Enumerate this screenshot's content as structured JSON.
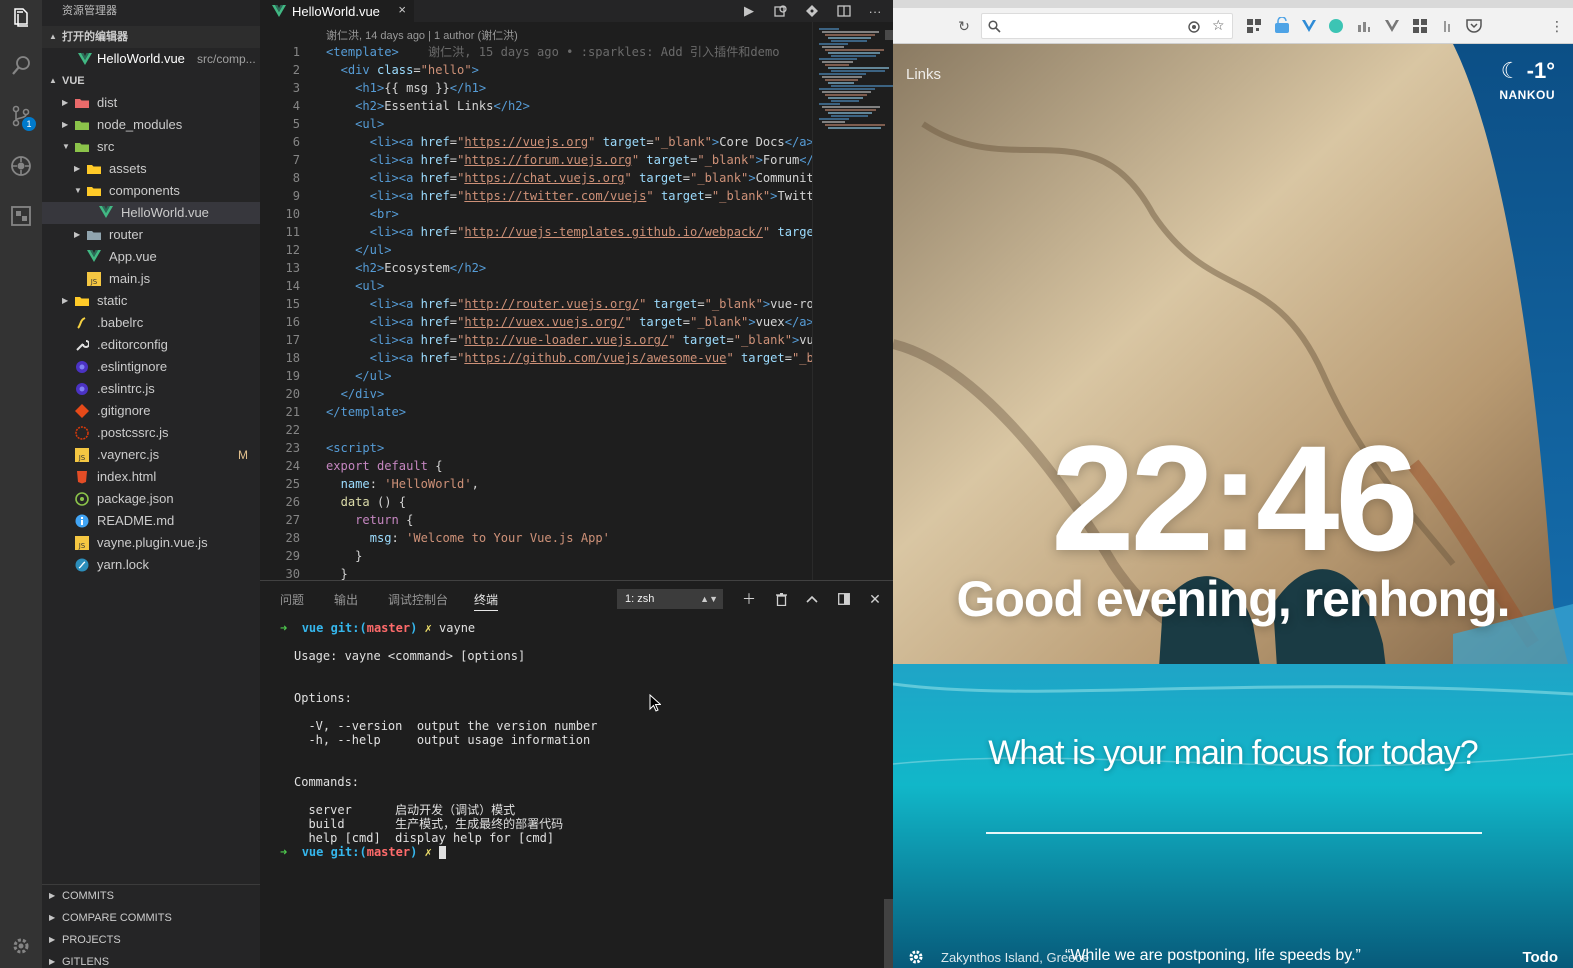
{
  "sidebar": {
    "title": "资源管理器",
    "open_editors": {
      "header": "打开的编辑器",
      "items": [
        {
          "name": "HelloWorld.vue",
          "path": "src/comp..."
        }
      ]
    },
    "project": {
      "header": "VUE",
      "tree": [
        {
          "name": "dist",
          "type": "folder"
        },
        {
          "name": "node_modules",
          "type": "folder"
        },
        {
          "name": "src",
          "type": "folder"
        },
        {
          "name": "assets",
          "type": "folder"
        },
        {
          "name": "components",
          "type": "folder"
        },
        {
          "name": "HelloWorld.vue",
          "type": "vue"
        },
        {
          "name": "router",
          "type": "folder"
        },
        {
          "name": "App.vue",
          "type": "vue"
        },
        {
          "name": "main.js",
          "type": "js"
        },
        {
          "name": "static",
          "type": "folder"
        },
        {
          "name": ".babelrc",
          "type": "babel"
        },
        {
          "name": ".editorconfig",
          "type": "config"
        },
        {
          "name": ".eslintignore",
          "type": "eslint"
        },
        {
          "name": ".eslintrc.js",
          "type": "eslint"
        },
        {
          "name": ".gitignore",
          "type": "git"
        },
        {
          "name": ".postcssrc.js",
          "type": "postcss"
        },
        {
          "name": ".vaynerc.js",
          "type": "js",
          "modified": "M"
        },
        {
          "name": "index.html",
          "type": "html"
        },
        {
          "name": "package.json",
          "type": "npm"
        },
        {
          "name": "README.md",
          "type": "info"
        },
        {
          "name": "vayne.plugin.vue.js",
          "type": "js"
        },
        {
          "name": "yarn.lock",
          "type": "yarn"
        }
      ]
    },
    "bottom_sections": [
      "COMMITS",
      "COMPARE COMMITS",
      "PROJECTS",
      "GITLENS"
    ]
  },
  "activity": {
    "scm_badge": "1"
  },
  "editor": {
    "tab_label": "HelloWorld.vue",
    "tab_close": "×",
    "blame_header": "谢仁洪, 14 days ago | 1 author (谢仁洪)",
    "blame_inline": "谢仁洪, 15 days ago • :sparkles: Add 引入插件和demo",
    "line_numbers": [
      "1",
      "2",
      "3",
      "4",
      "5",
      "6",
      "7",
      "8",
      "9",
      "10",
      "11",
      "12",
      "13",
      "14",
      "15",
      "16",
      "17",
      "18",
      "19",
      "20",
      "21",
      "22",
      "23",
      "24",
      "25",
      "26",
      "27",
      "28",
      "29",
      "30"
    ]
  },
  "panel": {
    "tabs": [
      "问题",
      "输出",
      "调试控制台",
      "终端"
    ],
    "terminal_select": "1: zsh",
    "terminal": {
      "prompt_dir": "vue",
      "prompt_git": "git:(",
      "prompt_branch": "master",
      "prompt_git_close": ")",
      "prompt_x": "✗",
      "command": "vayne",
      "usage": "Usage: vayne <command> [options]",
      "options_header": "Options:",
      "opt1": "  -V, --version  output the version number",
      "opt2": "  -h, --help     output usage information",
      "commands_header": "Commands:",
      "cmd1": "  server      启动开发（调试）模式",
      "cmd2": "  build       生产模式，生成最终的部署代码",
      "cmd3": "  help [cmd]  display help for [cmd]"
    }
  },
  "browser": {
    "links": "Links",
    "weather": {
      "temp": "-1°",
      "location": "NANKOU"
    },
    "clock": "22:46",
    "greeting": "Good evening, renhong.",
    "focus_question": "What is your main focus for today?",
    "footer_location": "Zakynthos Island, Greece",
    "footer_quote": "“While we are postponing, life speeds by.”",
    "footer_todo": "Todo"
  },
  "colors": {
    "activity_bar": "#333333",
    "sidebar_bg": "#252526",
    "editor_bg": "#1e1e1e",
    "accent": "#007acc",
    "vue_green": "#41b883"
  }
}
